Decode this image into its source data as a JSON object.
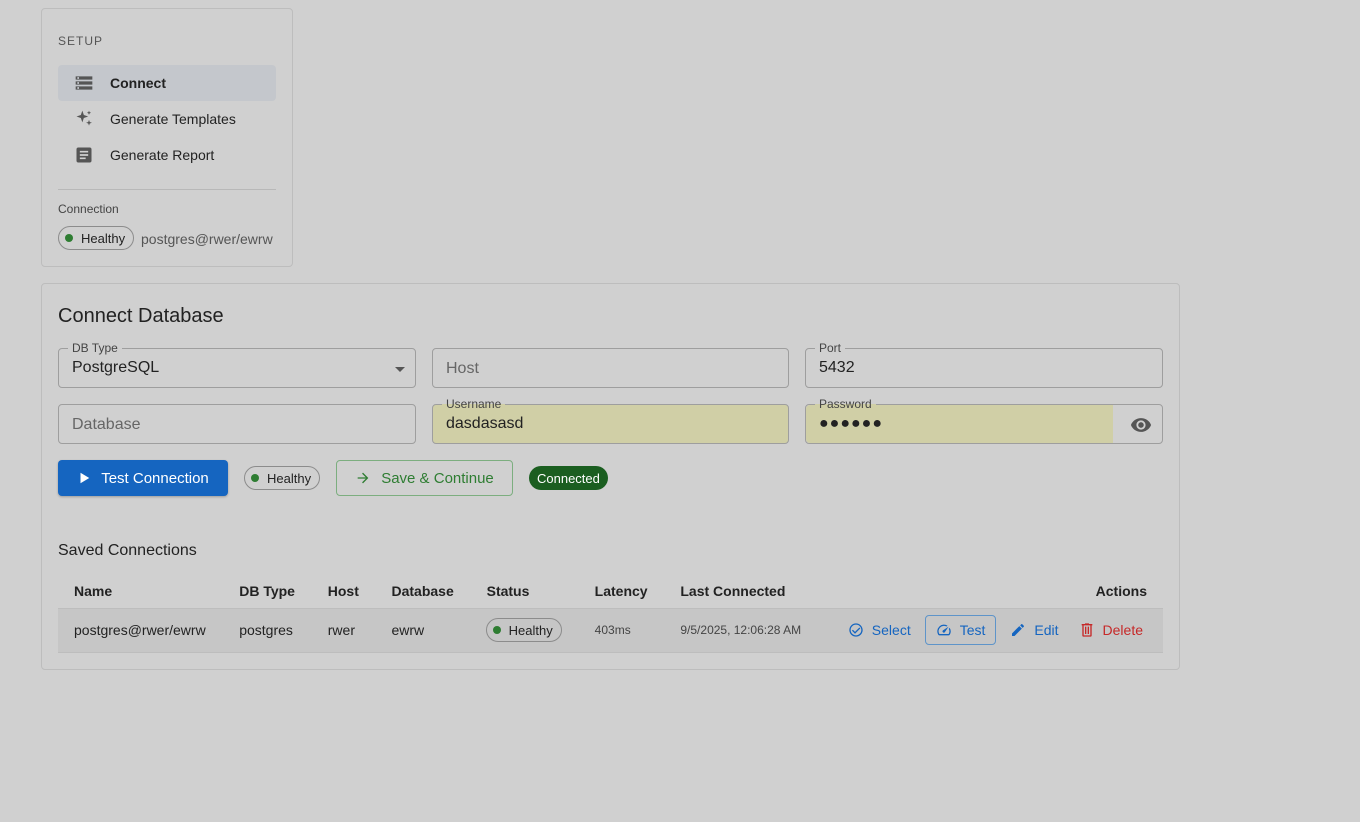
{
  "sidebar": {
    "section_title": "SETUP",
    "items": [
      {
        "label": "Connect",
        "icon": "storage-icon",
        "active": true
      },
      {
        "label": "Generate Templates",
        "icon": "sparkle-icon",
        "active": false
      },
      {
        "label": "Generate Report",
        "icon": "document-icon",
        "active": false
      }
    ],
    "connection_label": "Connection",
    "connection_status": "Healthy",
    "connection_string": "postgres@rwer/ewrw"
  },
  "connect_form": {
    "title": "Connect Database",
    "db_type": {
      "label": "DB Type",
      "value": "PostgreSQL"
    },
    "host": {
      "placeholder": "Host",
      "value": ""
    },
    "port": {
      "label": "Port",
      "value": "5432"
    },
    "database": {
      "placeholder": "Database",
      "value": ""
    },
    "username": {
      "label": "Username",
      "value": "dasdasasd"
    },
    "password": {
      "label": "Password",
      "value": "●●●●●●"
    },
    "test_button": "Test Connection",
    "test_status": "Healthy",
    "save_button": "Save & Continue",
    "connected_badge": "Connected"
  },
  "saved_connections": {
    "title": "Saved Connections",
    "columns": [
      "Name",
      "DB Type",
      "Host",
      "Database",
      "Status",
      "Latency",
      "Last Connected",
      "Actions"
    ],
    "rows": [
      {
        "name": "postgres@rwer/ewrw",
        "db_type": "postgres",
        "host": "rwer",
        "database": "ewrw",
        "status": "Healthy",
        "latency": "403ms",
        "last_connected": "9/5/2025, 12:06:28 AM",
        "actions": {
          "select": "Select",
          "test": "Test",
          "edit": "Edit",
          "delete": "Delete"
        }
      }
    ]
  },
  "colors": {
    "primary": "#1565c0",
    "success": "#2e7d32",
    "danger": "#c62828",
    "autofill": "#d0cfa6"
  }
}
